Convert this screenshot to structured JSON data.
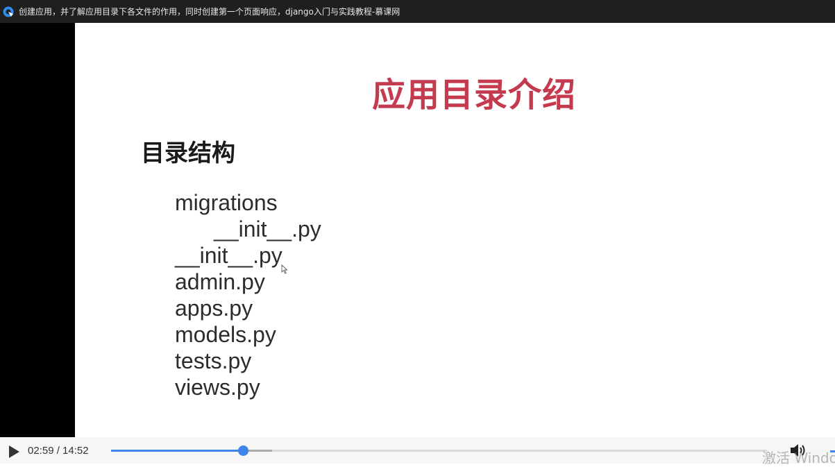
{
  "window": {
    "title": "创建应用，并了解应用目录下各文件的作用，同时创建第一个页面响应，django入门与实践教程-慕课网",
    "icon": "browser-logo-icon"
  },
  "slide": {
    "title": "应用目录介绍",
    "section_heading": "目录结构",
    "files": [
      {
        "name": "migrations",
        "indent": false
      },
      {
        "name": "__init__.py",
        "indent": true
      },
      {
        "name": "__init__.py",
        "indent": false
      },
      {
        "name": "admin.py",
        "indent": false
      },
      {
        "name": "apps.py",
        "indent": false
      },
      {
        "name": "models.py",
        "indent": false
      },
      {
        "name": "tests.py",
        "indent": false
      },
      {
        "name": "views.py",
        "indent": false
      }
    ]
  },
  "player": {
    "current_time": "02:59",
    "duration": "14:52",
    "time_display": "02:59 / 14:52",
    "progress_fraction": 0.2007,
    "buffered_fraction": 0.246,
    "accent_color": "#3d86e8",
    "play_icon": "play-icon",
    "volume_icon": "volume-icon"
  },
  "watermark": {
    "text": "激活 Windo"
  },
  "colors": {
    "title_red": "#c43a4f",
    "titlebar_bg": "#1f1f1f"
  }
}
